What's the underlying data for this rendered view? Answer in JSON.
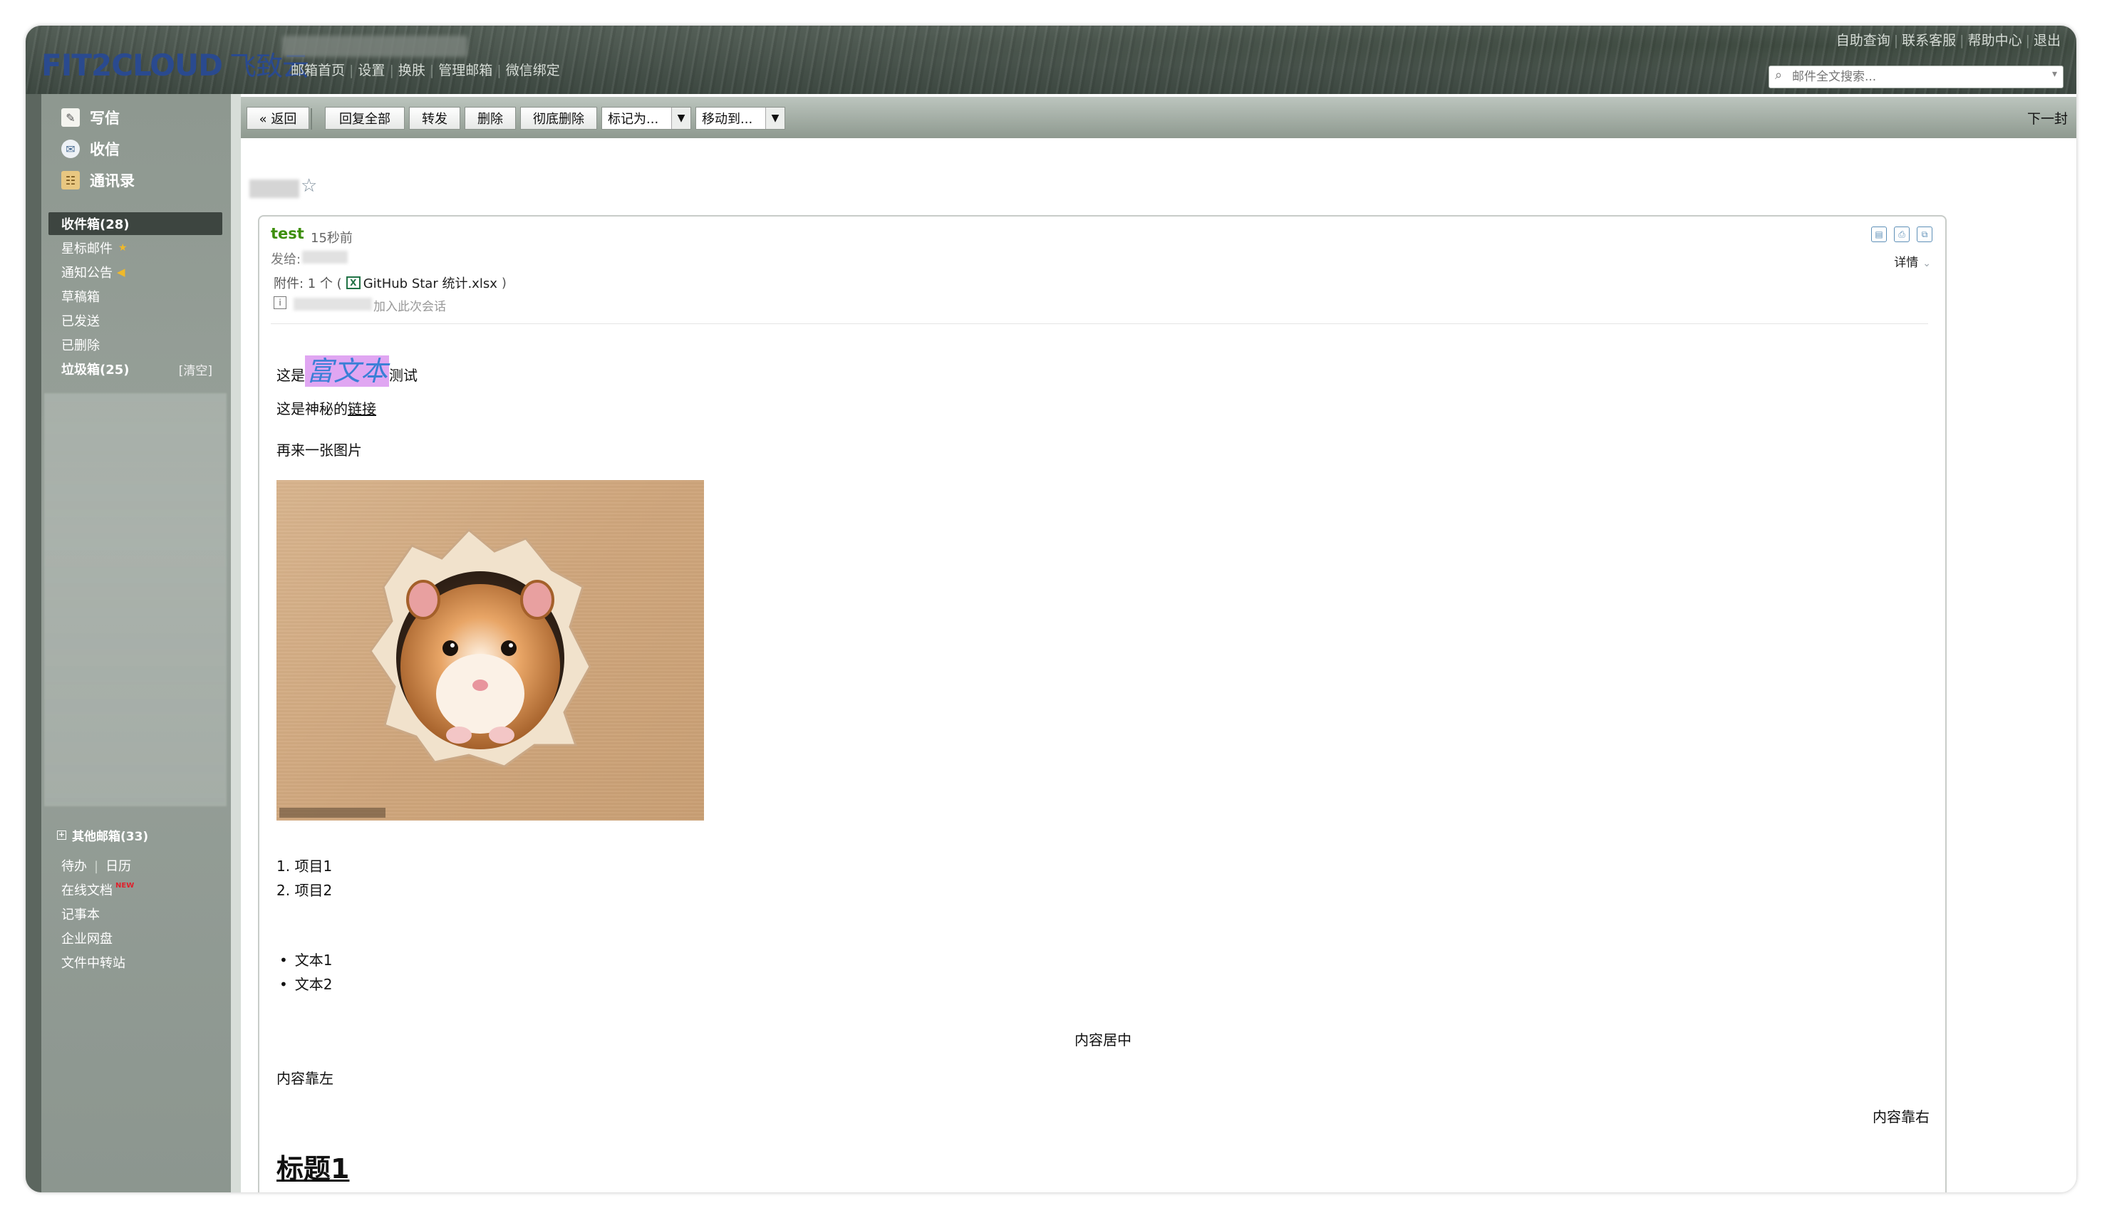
{
  "header": {
    "logo_latin": "FIT2CLOUD",
    "logo_cn": "飞致云",
    "nav": [
      "邮箱首页",
      "设置",
      "换肤",
      "管理邮箱",
      "微信绑定"
    ],
    "links": [
      "自助查询",
      "联系客服",
      "帮助中心",
      "退出"
    ],
    "search_placeholder": "邮件全文搜索..."
  },
  "sidebar": {
    "actions": [
      {
        "label": "写信",
        "icon": "pencil-icon"
      },
      {
        "label": "收信",
        "icon": "inbox-icon"
      },
      {
        "label": "通讯录",
        "icon": "contacts-icon"
      }
    ],
    "folders": [
      {
        "label": "收件箱(28)",
        "selected": true,
        "bold": true
      },
      {
        "label": "星标邮件",
        "badge": "star-icon"
      },
      {
        "label": "通知公告",
        "badge": "speaker-icon"
      },
      {
        "label": "草稿箱"
      },
      {
        "label": "已发送"
      },
      {
        "label": "已删除"
      },
      {
        "label": "垃圾箱(25)",
        "bold": true,
        "action": "[清空]"
      }
    ],
    "other_mailboxes": "其他邮箱(33)",
    "tools": {
      "todo": "待办",
      "calendar": "日历",
      "online_docs": "在线文档",
      "new_badge": "NEW",
      "notebook": "记事本",
      "netdisk": "企业网盘",
      "transfer": "文件中转站"
    }
  },
  "toolbar": {
    "back": "« 返回",
    "reply_all": "回复全部",
    "forward": "转发",
    "delete": "删除",
    "delete_forever": "彻底删除",
    "mark_as": "标记为...",
    "move_to": "移动到...",
    "next": "下一封"
  },
  "mail": {
    "sender": "test",
    "time": "15秒前",
    "to_label": "发给:",
    "attachment_prefix": "附件: 1 个 (",
    "attachment_name": "GitHub Star 统计.xlsx",
    "attachment_suffix": ")",
    "join_text": "加入此次会话",
    "detail": "详情"
  },
  "content": {
    "line1_prefix": "这是",
    "line1_rich": "富文本",
    "line1_suffix": "测试",
    "line2_prefix": "这是神秘的",
    "line2_link": "链接",
    "line3": "再来一张图片",
    "ordered": [
      "1. 项目1",
      "2. 项目2"
    ],
    "bullets": [
      "文本1",
      "文本2"
    ],
    "center_text": "内容居中",
    "left_text": "内容靠左",
    "right_text": "内容靠右",
    "heading": "标题1"
  }
}
